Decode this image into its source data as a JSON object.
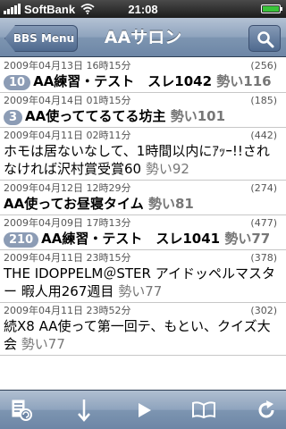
{
  "status": {
    "carrier": "SoftBank",
    "time": "21:08"
  },
  "nav": {
    "back_label": "BBS Menu",
    "title": "AAサロン",
    "search_icon": "search-icon"
  },
  "threads": [
    {
      "date": "2009年04月13日 16時15分",
      "count": "(256)",
      "badge": "10",
      "title": "AA練習・テスト　スレ1042",
      "ikioi": "勢い116",
      "bold": true
    },
    {
      "date": "2009年04月14日 01時15分",
      "count": "(185)",
      "badge": "3",
      "title": "AA使っててるてる坊主",
      "ikioi": "勢い101",
      "bold": true
    },
    {
      "date": "2009年04月11日 02時11分",
      "count": "(442)",
      "badge": "",
      "title": "ホモは居ないなして、1時間以内にｱｯｰ!!されなければ沢村賞受賞60",
      "ikioi": "勢い92",
      "bold": false
    },
    {
      "date": "2009年04月12日 12時29分",
      "count": "(274)",
      "badge": "",
      "title": "AA使ってお昼寝タイム",
      "ikioi": "勢い81",
      "bold": true
    },
    {
      "date": "2009年04月09日 17時13分",
      "count": "(477)",
      "badge": "210",
      "title": "AA練習・テスト　スレ1041",
      "ikioi": "勢い77",
      "bold": true
    },
    {
      "date": "2009年04月11日 23時15分",
      "count": "(378)",
      "badge": "",
      "title": "THE IDOPPELM＠STER アイドッペルマスター 暇人用267週目",
      "ikioi": "勢い77",
      "bold": false
    },
    {
      "date": "2009年04月11日 23時52分",
      "count": "(302)",
      "badge": "",
      "title": "続X8 AA使って第一回テ、もとい、クイズ大会",
      "ikioi": "勢い77",
      "bold": false
    }
  ],
  "toolbar": {
    "icons": [
      "history-icon",
      "arrow-down-icon",
      "play-icon",
      "book-icon",
      "refresh-icon"
    ]
  }
}
